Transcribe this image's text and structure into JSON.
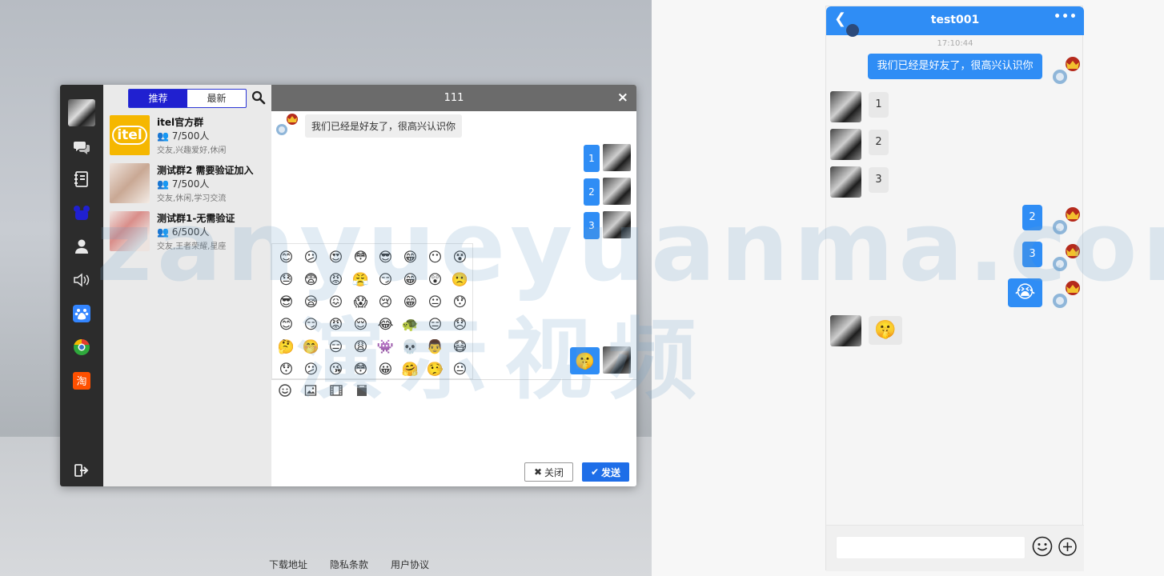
{
  "footer": {
    "links": [
      "下载地址",
      "隐私条款",
      "用户协议"
    ]
  },
  "sidebar": {
    "tabs": [
      {
        "label": "推荐"
      },
      {
        "label": "最新"
      }
    ]
  },
  "groups": [
    {
      "name": "itel官方群",
      "count": "7/500人",
      "tags": "交友,兴趣爱好,休闲",
      "logo_text": "itel"
    },
    {
      "name": "测试群2 需要验证加入",
      "count": "7/500人",
      "tags": "交友,休闲,学习交流"
    },
    {
      "name": "测试群1-无需验证",
      "count": "6/500人",
      "tags": "交友,王者荣耀,星座"
    }
  ],
  "chat": {
    "title": "111",
    "close_glyph": "×",
    "incoming": "我们已经是好友了，很高兴认识你",
    "outgoing": [
      "1",
      "2",
      "3"
    ],
    "emoji_sent": "🤫",
    "buttons": {
      "close": "关闭",
      "send": "发送"
    }
  },
  "emojis": [
    "😊",
    "😕",
    "😍",
    "😳",
    "😎",
    "😁",
    "😶",
    "😵",
    "😓",
    "😨",
    "😡",
    "😤",
    "😏",
    "😁",
    "😲",
    "🙁",
    "😎",
    "😪",
    "😖",
    "😱",
    "😢",
    "😁",
    "😐",
    "😯",
    "😊",
    "😏",
    "😡",
    "😌",
    "😂",
    "🐢",
    "😑",
    "😞",
    "🤔",
    "🤭",
    "😑",
    "😩",
    "👾",
    "💀",
    "👨",
    "😷",
    "😯",
    "😕",
    "😘",
    "😳",
    "😀",
    "🤗",
    "🤥",
    "😐"
  ],
  "mobile": {
    "title": "test001",
    "time": "17:10:44",
    "greeting": "我们已经是好友了，很高兴认识你",
    "left_msgs": [
      "1",
      "2",
      "3"
    ],
    "right_msgs": [
      "2",
      "3"
    ],
    "right_emoji": "😭",
    "left_emoji": "🤫",
    "input_placeholder": ""
  },
  "watermark": {
    "line1": "zanyueyuanma.com",
    "line2": "演示视频"
  },
  "colors": {
    "primary": "#2f8df5",
    "tab_active": "#2020d0",
    "send": "#1e6ee8",
    "rail": "#2c2c2c"
  }
}
